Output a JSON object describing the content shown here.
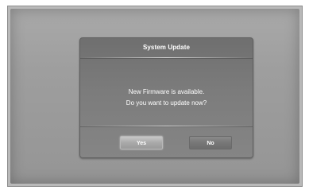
{
  "dialog": {
    "title": "System Update",
    "message_line1": "New Firmware is available.",
    "message_line2": "Do you want to update now?",
    "buttons": {
      "yes_label": "Yes",
      "no_label": "No"
    }
  },
  "colors": {
    "screen_background": "#9e9e9e",
    "dialog_background": "#7c7c7c",
    "text": "#ffffff",
    "focused_button": "#b5b5b5",
    "unfocused_button": "#777777"
  }
}
